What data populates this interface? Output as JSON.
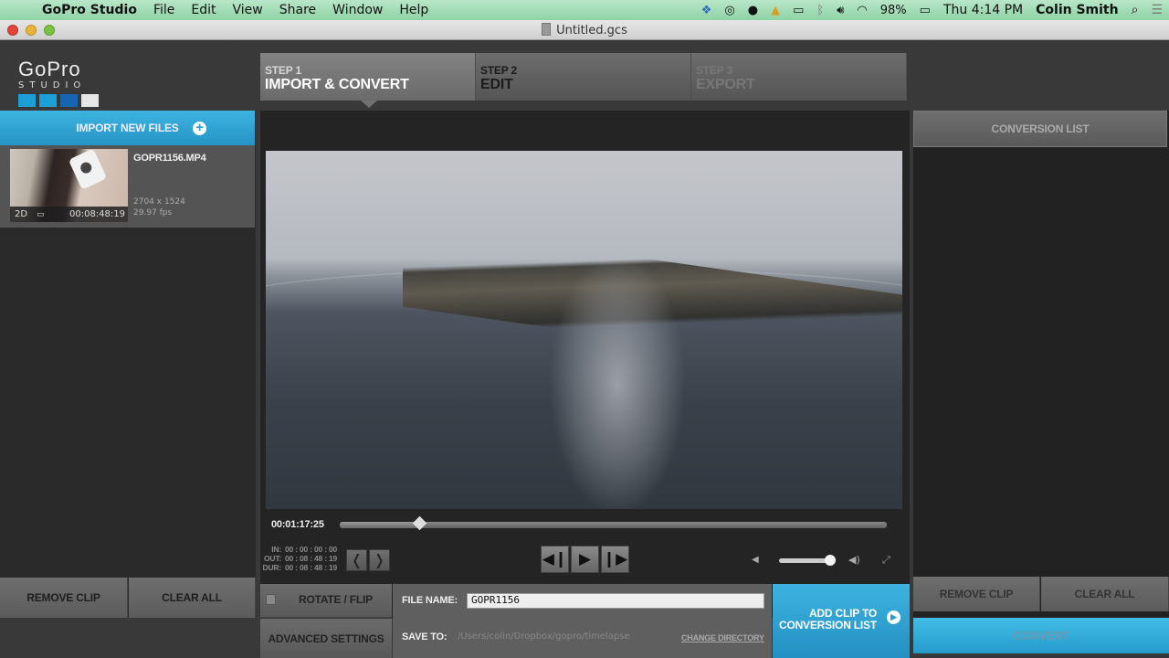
{
  "menubar": {
    "app_name": "GoPro Studio",
    "items": [
      "File",
      "Edit",
      "View",
      "Share",
      "Window",
      "Help"
    ],
    "status": {
      "battery": "98%",
      "clock": "Thu 4:14 PM",
      "user": "Colin Smith"
    }
  },
  "window": {
    "title": "Untitled.gcs"
  },
  "logo": {
    "word": "GoPro",
    "sub": "STUDIO",
    "colors": [
      "#1b9fd6",
      "#1b9fd6",
      "#1565b3",
      "#e6e6e6"
    ]
  },
  "steps": [
    {
      "num": "STEP 1",
      "label": "IMPORT & CONVERT",
      "state": "active"
    },
    {
      "num": "STEP 2",
      "label": "EDIT",
      "state": "enabled"
    },
    {
      "num": "STEP 3",
      "label": "EXPORT",
      "state": "disabled"
    }
  ],
  "import_panel": {
    "import_label": "IMPORT NEW FILES",
    "clip": {
      "name": "GOPR1156.MP4",
      "mode": "2D",
      "duration": "00:08:48:19",
      "resolution": "2704 x 1524",
      "fps": "29.97 fps"
    },
    "remove_label": "REMOVE CLIP",
    "clear_label": "CLEAR ALL"
  },
  "player": {
    "timecode": "00:01:17:25",
    "playhead_fraction": 0.145,
    "in_label": "IN:",
    "in_value": "00 : 00 : 00 : 00",
    "out_label": "OUT:",
    "out_value": "00 : 08 : 48 : 19",
    "dur_label": "DUR:",
    "dur_value": "00 : 08 : 48 : 19",
    "volume_fraction": 1.0
  },
  "convert_options": {
    "rotate_label": "ROTATE / FLIP",
    "rotate_checked": false,
    "advanced_label": "ADVANCED SETTINGS",
    "file_name_label": "FILE NAME:",
    "file_name_value": "GOPR1156",
    "save_to_label": "SAVE TO:",
    "save_to_path": "/Users/colin/Dropbox/gopro/timelapse",
    "change_dir_label": "CHANGE DIRECTORY",
    "add_clip_line1": "ADD CLIP TO",
    "add_clip_line2": "CONVERSION LIST"
  },
  "conversion_panel": {
    "header": "CONVERSION LIST",
    "remove_label": "REMOVE CLIP",
    "clear_label": "CLEAR ALL",
    "convert_label": "CONVERT"
  }
}
